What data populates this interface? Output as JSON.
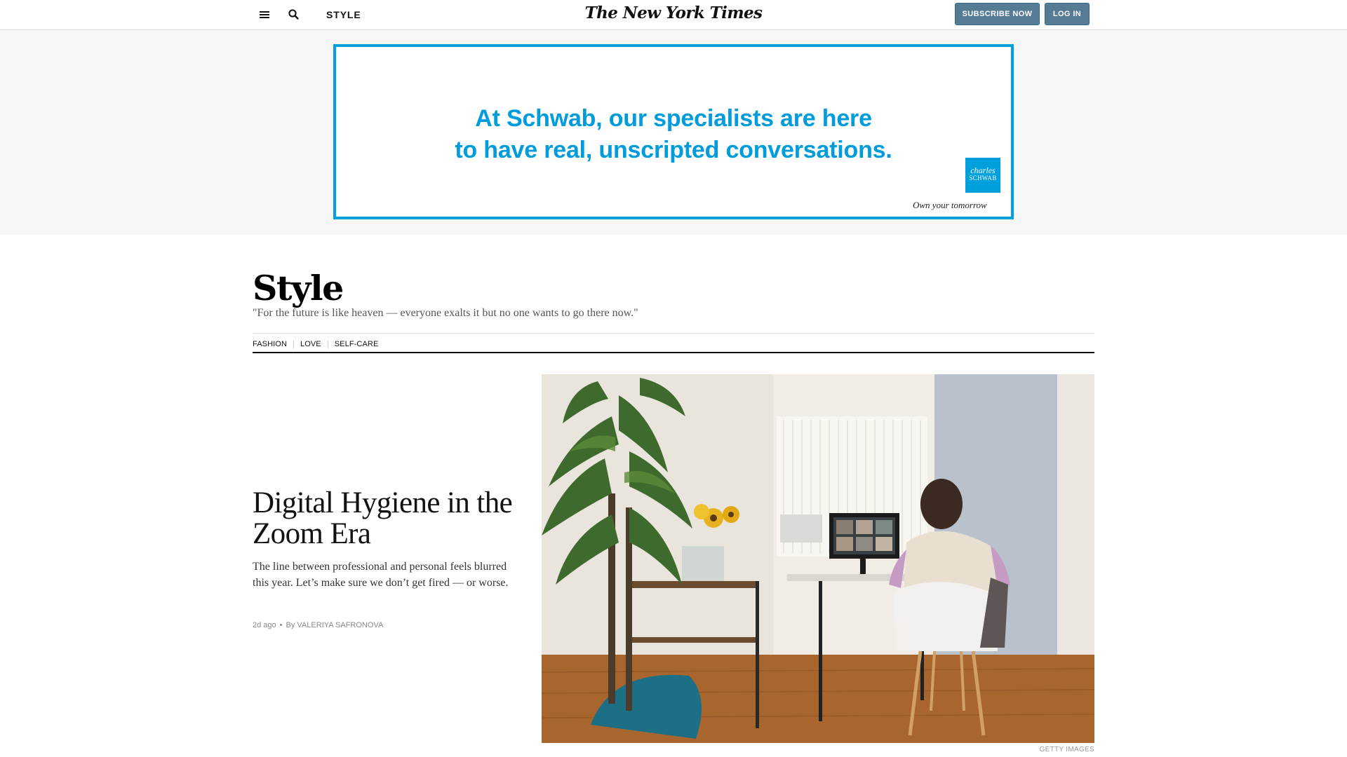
{
  "header": {
    "section_label": "STYLE",
    "logo_text": "The New York Times",
    "subscribe_label": "SUBSCRIBE NOW",
    "login_label": "LOG IN",
    "button_color": "#567b95"
  },
  "ad": {
    "line1": "At Schwab, our specialists are here",
    "line2": "to have real, unscripted conversations.",
    "brand_line1": "charles",
    "brand_line2": "SCHWAB",
    "tagline": "Own your tomorrow",
    "accent_color": "#00a0df"
  },
  "section": {
    "title": "Style",
    "quote": "\"For the future is like heaven — everyone exalts it but no one wants to go there now.\"",
    "nav": [
      "FASHION",
      "LOVE",
      "SELF-CARE"
    ]
  },
  "lead_story": {
    "headline": "Digital Hygiene in the Zoom Era",
    "summary": "The line between professional and personal feels blurred this year. Let’s make sure we don’t get fired — or worse.",
    "time": "2d ago",
    "byline": "By VALERIYA SAFRONOVA",
    "image_credit": "GETTY IMAGES"
  },
  "icons": {
    "menu": "menu-icon",
    "search": "search-icon"
  }
}
